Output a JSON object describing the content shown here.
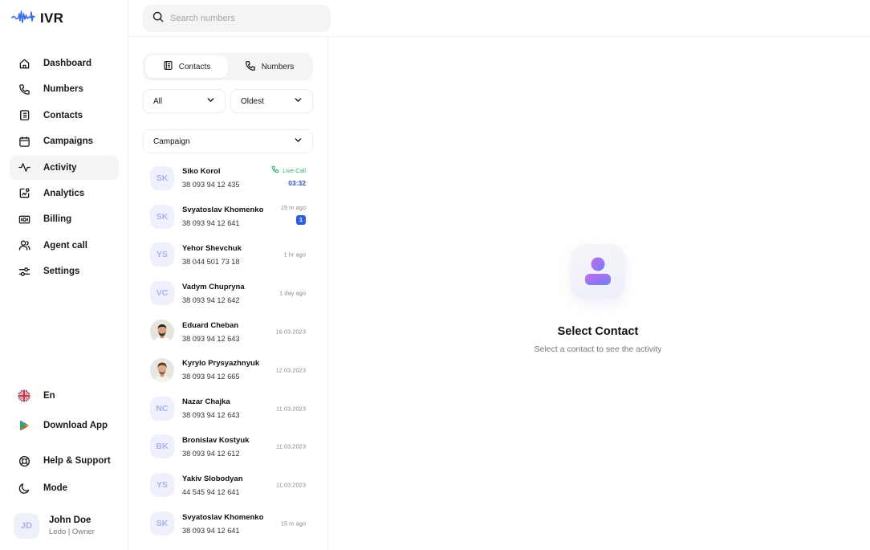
{
  "app": {
    "logo_text": "IVR"
  },
  "search": {
    "placeholder": "Search numbers"
  },
  "sidebar": {
    "items": [
      {
        "label": "Dashboard",
        "icon": "home-icon"
      },
      {
        "label": "Numbers",
        "icon": "phone-icon"
      },
      {
        "label": "Contacts",
        "icon": "contacts-book-icon"
      },
      {
        "label": "Campaigns",
        "icon": "calendar-icon"
      },
      {
        "label": "Activity",
        "icon": "activity-pulse-icon",
        "active": true
      },
      {
        "label": "Analytics",
        "icon": "analytics-icon"
      },
      {
        "label": "Billing",
        "icon": "billing-icon"
      },
      {
        "label": "Agent call",
        "icon": "agent-icon"
      },
      {
        "label": "Settings",
        "icon": "settings-sliders-icon"
      }
    ],
    "language": "En",
    "download": "Download App",
    "help": "Help & Support",
    "mode": "Mode",
    "user": {
      "initials": "JD",
      "name": "John Doe",
      "role": "Ledo | Owner"
    }
  },
  "tabs": {
    "contacts": "Contacts",
    "numbers": "Numbers",
    "active": "contacts"
  },
  "filters": {
    "status": "All",
    "sort": "Oldest",
    "campaign": "Campaign"
  },
  "contacts": [
    {
      "initials": "SK",
      "name": "Siko Korol",
      "phone": "38 093 94 12 435",
      "live_label": "Live Call",
      "timer": "03:32"
    },
    {
      "initials": "SK",
      "name": "Svyatoslav Khomenko",
      "phone": "38 093 94 12 641",
      "time": "15 m ago",
      "badge": "1"
    },
    {
      "initials": "YS",
      "name": "Yehor Shevchuk",
      "phone": "38 044 501 73 18",
      "time": "1 hr ago"
    },
    {
      "initials": "VC",
      "name": "Vadym Chupryna",
      "phone": "38 093 94 12 642",
      "time": "1 day ago"
    },
    {
      "initials": "",
      "photo": true,
      "name": "Eduard Cheban",
      "phone": "38 093 94 12 643",
      "time": "16.03.2023"
    },
    {
      "initials": "",
      "photo": true,
      "name": "Kyrylo Prysyazhnyuk",
      "phone": "38 093 94 12 665",
      "time": "12.03.2023"
    },
    {
      "initials": "NC",
      "name": "Nazar Chajka",
      "phone": "38 093 94 12 643",
      "time": "11.03.2023"
    },
    {
      "initials": "BK",
      "name": "Bronislav Kostyuk",
      "phone": "38 093 94 12 612",
      "time": "11.03.2023"
    },
    {
      "initials": "YS",
      "name": "Yakiv Slobodyan",
      "phone": "44 545 94 12 641",
      "time": "11.03.2023"
    },
    {
      "initials": "SK",
      "name": "Svyatoslav Khomenko",
      "phone": "38 093 94 12 641",
      "time": "15 m ago"
    }
  ],
  "empty_state": {
    "title": "Select Contact",
    "subtitle": "Select a contact to see the activity"
  },
  "colors": {
    "live_green": "#2fb062",
    "timer_blue": "#2a55d8",
    "badge_blue": "#2f5fe0",
    "avatar_bg": "#eef0fb",
    "avatar_text": "#a9b3ea",
    "accent_purple": "#8f6cf0"
  }
}
